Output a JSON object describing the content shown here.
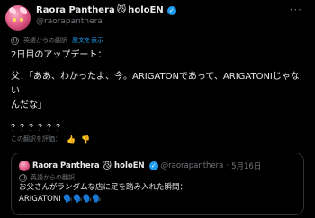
{
  "author": {
    "name": "Raora Panthera",
    "name_suffix": "holoEN",
    "cat_emoji": "😼",
    "handle": "@raorapanthera"
  },
  "translation_bar": {
    "label": "英語からの翻訳",
    "link": "原文を表示"
  },
  "tweet": {
    "line1": "2日目のアップデート：",
    "line2": "父：「ああ、わかったよ、今。ARIGATONであって、ARIGATONIじゃない",
    "line3": "んだな」",
    "line4": "？？？？？？"
  },
  "rate_translation": "この翻訳を評価：",
  "quote": {
    "name": "Raora Panthera",
    "name_suffix": "holoEN",
    "handle": "@raorapanthera",
    "date": "5月16日",
    "translation_label": "英語からの翻訳",
    "text_line1": "お父さんがランダムな店に足を踏み入れた瞬間：",
    "text_line2": "ARIGATONI 🗣️🗣️🗣️🗣️"
  },
  "colors": {
    "background": "#000000",
    "text": "#e7e9ea",
    "muted": "#71767b",
    "link": "#1d9bf0",
    "border": "#2f3336"
  }
}
